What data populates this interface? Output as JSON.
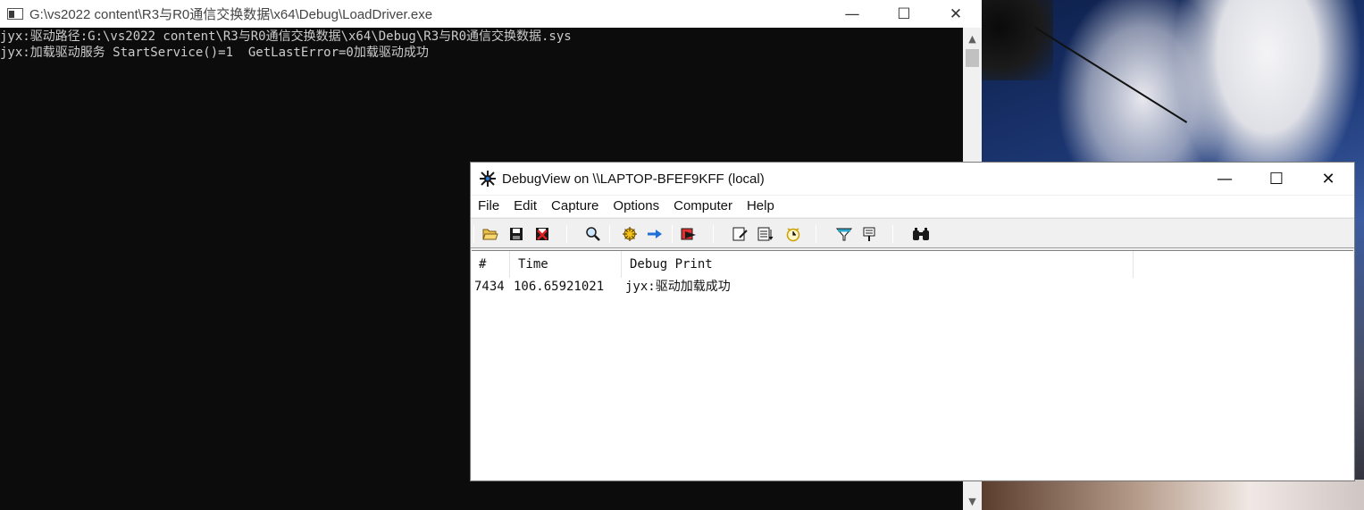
{
  "console": {
    "title": "G:\\vs2022 content\\R3与R0通信交换数据\\x64\\Debug\\LoadDriver.exe",
    "lines": [
      "jyx:驱动路径:G:\\vs2022 content\\R3与R0通信交换数据\\x64\\Debug\\R3与R0通信交换数据.sys",
      "jyx:加载驱动服务 StartService()=1  GetLastError=0加载驱动成功"
    ],
    "minimize_glyph": "—",
    "maximize_glyph": "☐",
    "close_glyph": "✕",
    "scroll_up_glyph": "▲",
    "scroll_down_glyph": "▼"
  },
  "debugview": {
    "title": "DebugView on \\\\LAPTOP-BFEF9KFF (local)",
    "menu": [
      "File",
      "Edit",
      "Capture",
      "Options",
      "Computer",
      "Help"
    ],
    "toolbar": [
      {
        "name": "open-icon",
        "glyph": "📂"
      },
      {
        "name": "save-icon",
        "glyph": "💾"
      },
      {
        "name": "clear-icon",
        "glyph": "🗑"
      },
      {
        "name": "find-icon",
        "glyph": "🔍"
      },
      {
        "name": "capture-icon",
        "glyph": "⚙"
      },
      {
        "name": "autoscroll-icon",
        "glyph": "➡"
      },
      {
        "name": "highlight-icon",
        "glyph": "✖"
      },
      {
        "name": "filter-icon",
        "glyph": "✎"
      },
      {
        "name": "history-icon",
        "glyph": "≣"
      },
      {
        "name": "clock-icon",
        "glyph": "⏱"
      },
      {
        "name": "highlight-filter-icon",
        "glyph": "▼"
      },
      {
        "name": "memo-icon",
        "glyph": "⚑"
      },
      {
        "name": "binoculars-icon",
        "glyph": "👓"
      }
    ],
    "columns": [
      "#",
      "Time",
      "Debug Print"
    ],
    "rows": [
      {
        "num": "7434",
        "time": "106.65921021",
        "text": "jyx:驱动加载成功"
      }
    ],
    "minimize_glyph": "—",
    "maximize_glyph": "☐",
    "close_glyph": "✕"
  },
  "colors": {
    "console_bg": "#0c0c0c",
    "console_text": "#cccccc",
    "window_bg": "#f0f0f0",
    "accent_blue": "#1e6fd9"
  }
}
